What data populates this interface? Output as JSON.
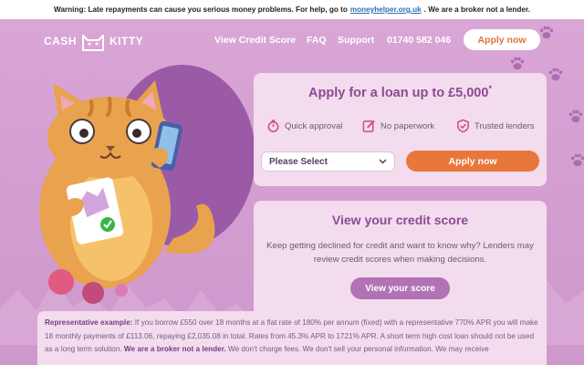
{
  "warning": {
    "text_before": "Warning: Late repayments can cause you serious money problems. For help, go to",
    "link": "moneyhelper.org.uk",
    "text_after": ". We are a broker not a lender."
  },
  "header": {
    "logo_left": "CASH",
    "logo_right": "KITTY",
    "nav": [
      "View Credit Score",
      "FAQ",
      "Support",
      "01740 582 046"
    ],
    "apply_button": "Apply now"
  },
  "loan_card": {
    "title": "Apply for a loan up to £5,000",
    "title_mark": "*",
    "features": [
      "Quick approval",
      "No paperwork",
      "Trusted lenders"
    ],
    "select_value": "Please Select",
    "apply_button": "Apply now"
  },
  "credit_card": {
    "title": "View your credit score",
    "text": "Keep getting declined for credit and want to know why? Lenders may review credit scores when making decisions.",
    "button": "View your score"
  },
  "representative": {
    "label": "Representative example:",
    "text": " If you borrow £550 over 18 months at a flat rate of 180% per annum (fixed) with a representative 770% APR you will make 18 monthly payments of £113.06, repaying £2,035.08 in total. Rates from 45.3% APR to 1721% APR. A short term high cost loan should not be used as a long term solution.",
    "bold_tail": " We are a broker not a lender.",
    "tail": " We don't charge fees. We don't sell your personal information. We may receive"
  },
  "colors": {
    "background": "#d6a2d2",
    "card": "#f3dcee",
    "accent_orange": "#e9773b",
    "accent_purple": "#8c4a92"
  },
  "icons": [
    "cash-kitty-logo-icon",
    "stopwatch-icon",
    "edit-icon",
    "shield-check-icon",
    "chevron-down-icon",
    "paw-icon"
  ]
}
